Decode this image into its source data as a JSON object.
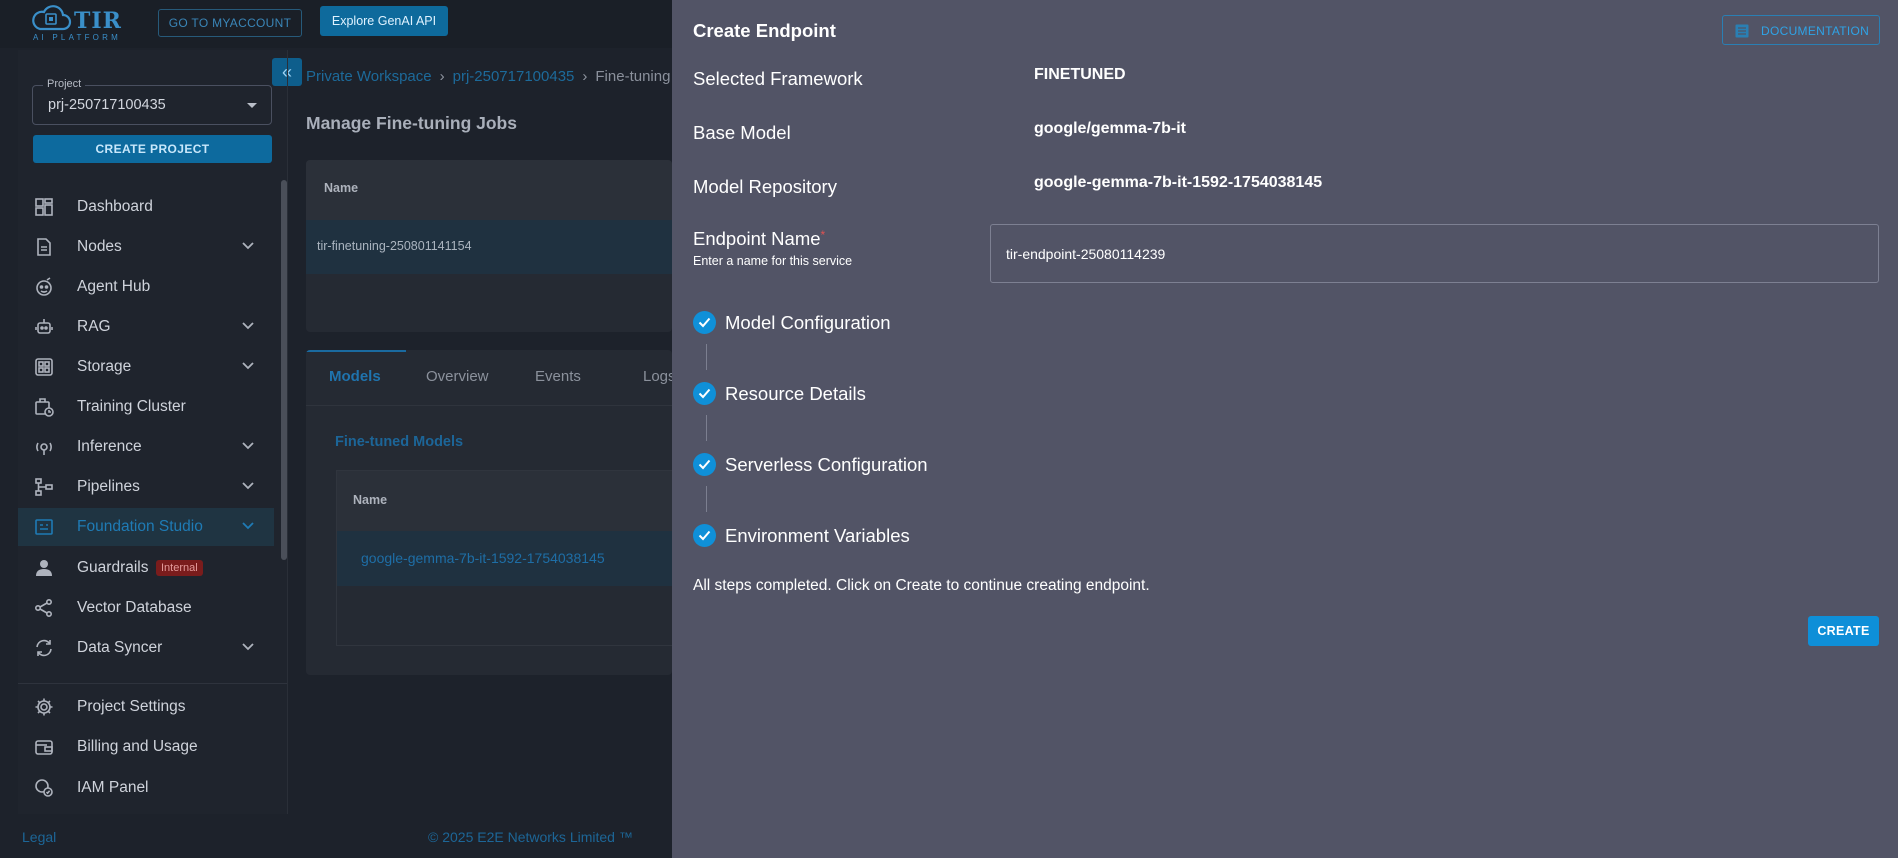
{
  "header": {
    "logo_text": "TIR",
    "logo_subtext": "AI PLATFORM",
    "myaccount_button": "GO TO MYACCOUNT",
    "genai_button": "Explore GenAI API"
  },
  "sidebar": {
    "project_label": "Project",
    "project_value": "prj-250717100435",
    "create_project_button": "CREATE PROJECT",
    "items": [
      {
        "label": "Dashboard",
        "icon": "dashboard-icon"
      },
      {
        "label": "Nodes",
        "icon": "nodes-icon"
      },
      {
        "label": "Agent Hub",
        "icon": "agent-hub-icon"
      },
      {
        "label": "RAG",
        "icon": "rag-icon"
      },
      {
        "label": "Storage",
        "icon": "storage-icon"
      },
      {
        "label": "Training Cluster",
        "icon": "training-cluster-icon"
      },
      {
        "label": "Inference",
        "icon": "inference-icon"
      },
      {
        "label": "Pipelines",
        "icon": "pipelines-icon"
      },
      {
        "label": "Foundation Studio",
        "icon": "foundation-studio-icon"
      },
      {
        "label": "Guardrails",
        "icon": "guardrails-icon",
        "badge": "Internal"
      },
      {
        "label": "Vector Database",
        "icon": "vector-database-icon"
      },
      {
        "label": "Data Syncer",
        "icon": "data-syncer-icon"
      }
    ],
    "bottom_items": [
      {
        "label": "Project Settings",
        "icon": "settings-icon"
      },
      {
        "label": "Billing and Usage",
        "icon": "billing-icon"
      },
      {
        "label": "IAM Panel",
        "icon": "iam-icon"
      }
    ]
  },
  "breadcrumb": {
    "items": [
      "Private Workspace",
      "prj-250717100435",
      "Fine-tuning"
    ],
    "separator": "›"
  },
  "main": {
    "title": "Manage Fine-tuning Jobs",
    "jobs_table": {
      "header": "Name",
      "rows": [
        "tir-finetuning-250801141154"
      ]
    },
    "tabs": [
      "Models",
      "Overview",
      "Events",
      "Logs"
    ],
    "models_section": {
      "title": "Fine-tuned Models",
      "header": "Name",
      "rows": [
        "google-gemma-7b-it-1592-1754038145"
      ]
    }
  },
  "footer": {
    "legal": "Legal",
    "copyright": "© 2025 E2E Networks Limited ™"
  },
  "drawer": {
    "title": "Create Endpoint",
    "documentation_button": "DOCUMENTATION",
    "fields": {
      "framework_label": "Selected Framework",
      "framework_value": "FINETUNED",
      "base_model_label": "Base Model",
      "base_model_value": "google/gemma-7b-it",
      "repo_label": "Model Repository",
      "repo_value": "google-gemma-7b-it-1592-1754038145"
    },
    "endpoint_name": {
      "label": "Endpoint Name",
      "required_mark": "*",
      "hint": "Enter a name for this service",
      "value": "tir-endpoint-25080114239"
    },
    "steps": [
      "Model Configuration",
      "Resource Details",
      "Serverless Configuration",
      "Environment Variables"
    ],
    "completion_message": "All steps completed. Click on Create to continue creating endpoint.",
    "create_button": "CREATE"
  },
  "colors": {
    "accent": "#0f90d8",
    "drawer_bg": "#525466",
    "page_bg": "#1d222b",
    "badge_bg": "#7a1c1c"
  }
}
